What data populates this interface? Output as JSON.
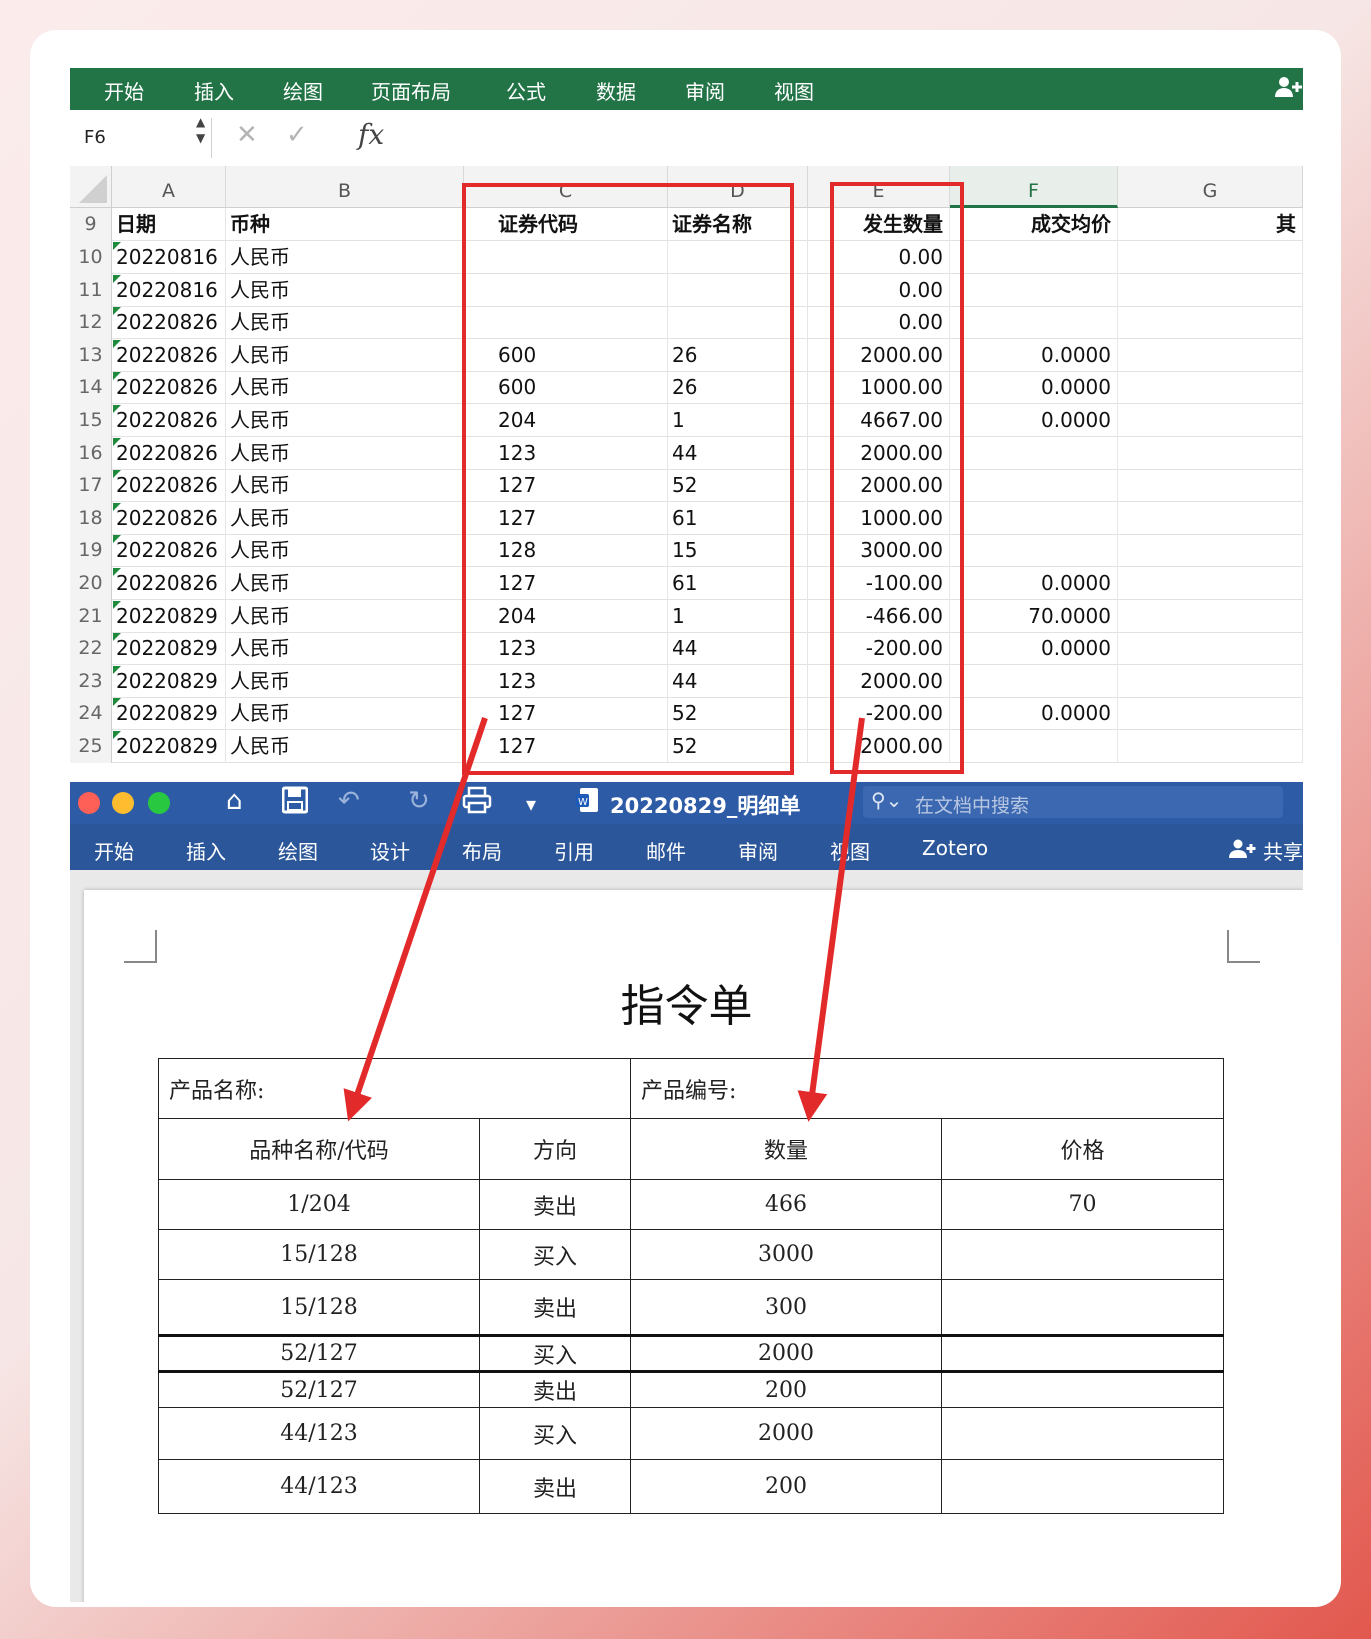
{
  "excel": {
    "ribbon_tabs": [
      "开始",
      "插入",
      "绘图",
      "页面布局",
      "公式",
      "数据",
      "审阅",
      "视图"
    ],
    "user_icon": "add-user-icon",
    "name_box": "F6",
    "formula_bar": {
      "cancel": "✕",
      "confirm": "✓",
      "fx": "fx"
    },
    "columns": [
      "A",
      "B",
      "C",
      "D",
      "E",
      "F",
      "G"
    ],
    "active_column": "F",
    "header_row": {
      "num": "9",
      "date": "日期",
      "currency": "币种",
      "code": "证券代码",
      "name": "证券名称",
      "qty": "发生数量",
      "price": "成交均价",
      "other": "其"
    },
    "rows": [
      {
        "num": "10",
        "date": "20220816",
        "currency": "人民币",
        "code": "",
        "name": "",
        "qty": "0.00",
        "price": ""
      },
      {
        "num": "11",
        "date": "20220816",
        "currency": "人民币",
        "code": "",
        "name": "",
        "qty": "0.00",
        "price": ""
      },
      {
        "num": "12",
        "date": "20220826",
        "currency": "人民币",
        "code": "",
        "name": "",
        "qty": "0.00",
        "price": ""
      },
      {
        "num": "13",
        "date": "20220826",
        "currency": "人民币",
        "code": "600",
        "name": "26",
        "qty": "2000.00",
        "price": "0.0000"
      },
      {
        "num": "14",
        "date": "20220826",
        "currency": "人民币",
        "code": "600",
        "name": "26",
        "qty": "1000.00",
        "price": "0.0000"
      },
      {
        "num": "15",
        "date": "20220826",
        "currency": "人民币",
        "code": "204",
        "name": "1",
        "qty": "4667.00",
        "price": "0.0000"
      },
      {
        "num": "16",
        "date": "20220826",
        "currency": "人民币",
        "code": "123",
        "name": "44",
        "qty": "2000.00",
        "price": ""
      },
      {
        "num": "17",
        "date": "20220826",
        "currency": "人民币",
        "code": "127",
        "name": "52",
        "qty": "2000.00",
        "price": ""
      },
      {
        "num": "18",
        "date": "20220826",
        "currency": "人民币",
        "code": "127",
        "name": "61",
        "qty": "1000.00",
        "price": ""
      },
      {
        "num": "19",
        "date": "20220826",
        "currency": "人民币",
        "code": "128",
        "name": "15",
        "qty": "3000.00",
        "price": ""
      },
      {
        "num": "20",
        "date": "20220826",
        "currency": "人民币",
        "code": "127",
        "name": "61",
        "qty": "-100.00",
        "price": "0.0000"
      },
      {
        "num": "21",
        "date": "20220829",
        "currency": "人民币",
        "code": "204",
        "name": "1",
        "qty": "-466.00",
        "price": "70.0000"
      },
      {
        "num": "22",
        "date": "20220829",
        "currency": "人民币",
        "code": "123",
        "name": "44",
        "qty": "-200.00",
        "price": "0.0000"
      },
      {
        "num": "23",
        "date": "20220829",
        "currency": "人民币",
        "code": "123",
        "name": "44",
        "qty": "2000.00",
        "price": ""
      },
      {
        "num": "24",
        "date": "20220829",
        "currency": "人民币",
        "code": "127",
        "name": "52",
        "qty": "-200.00",
        "price": "0.0000"
      },
      {
        "num": "25",
        "date": "20220829",
        "currency": "人民币",
        "code": "127",
        "name": "52",
        "qty": "2000.00",
        "price": ""
      }
    ]
  },
  "word": {
    "doc_name": "20220829_明细单",
    "search_placeholder": "在文档中搜索",
    "tabs": [
      "开始",
      "插入",
      "绘图",
      "设计",
      "布局",
      "引用",
      "邮件",
      "审阅",
      "视图",
      "Zotero"
    ],
    "share": "共享",
    "title": "指令单",
    "product_name_label": "产品名称:",
    "product_code_label": "产品编号:",
    "table_headers": [
      "品种名称/代码",
      "方向",
      "数量",
      "价格"
    ],
    "table_rows": [
      [
        "1/204",
        "卖出",
        "466",
        "70"
      ],
      [
        "15/128",
        "买入",
        "3000",
        ""
      ],
      [
        "15/128",
        "卖出",
        "300",
        ""
      ],
      [
        "52/127",
        "买入",
        "2000",
        ""
      ],
      [
        "52/127",
        "卖出",
        "200",
        ""
      ],
      [
        "44/123",
        "买入",
        "2000",
        ""
      ],
      [
        "44/123",
        "卖出",
        "200",
        ""
      ]
    ]
  },
  "colors": {
    "excel_green": "#227447",
    "word_blue": "#2b579a",
    "annotation_red": "#e32a2a"
  }
}
